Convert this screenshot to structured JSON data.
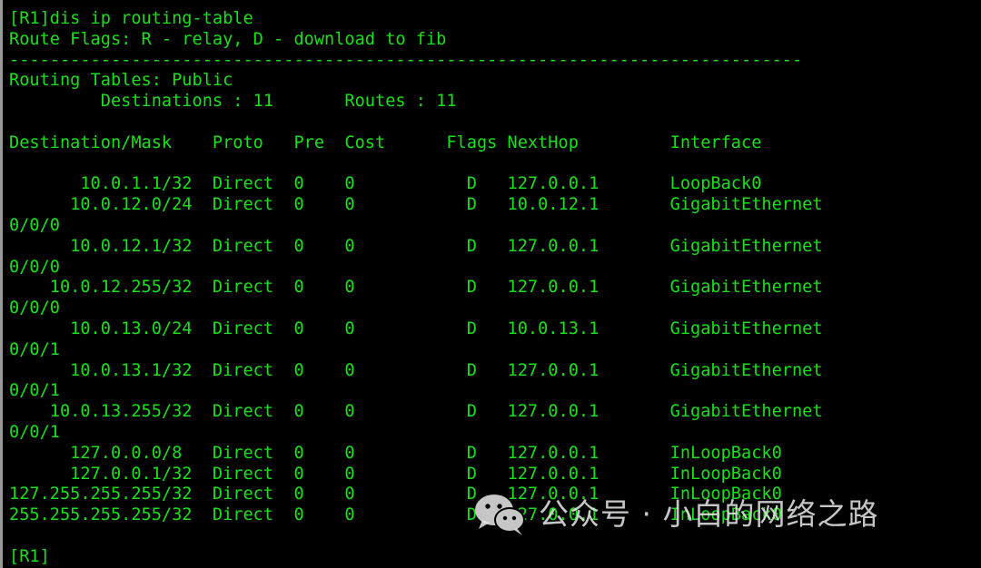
{
  "terminal": {
    "prompt_command": "[R1]dis ip routing-table",
    "flags_legend": "Route Flags: R - relay, D - download to fib",
    "separator": "------------------------------------------------------------------------------",
    "routing_tables": "Routing Tables: Public",
    "summary": "         Destinations : 11       Routes : 11",
    "blank_1": "",
    "header": "Destination/Mask    Proto   Pre  Cost      Flags NextHop         Interface",
    "blank_2": "",
    "routes": [
      "       10.0.1.1/32  Direct  0    0           D   127.0.0.1       LoopBack0",
      "      10.0.12.0/24  Direct  0    0           D   10.0.12.1       GigabitEthernet",
      "0/0/0",
      "      10.0.12.1/32  Direct  0    0           D   127.0.0.1       GigabitEthernet",
      "0/0/0",
      "    10.0.12.255/32  Direct  0    0           D   127.0.0.1       GigabitEthernet",
      "0/0/0",
      "      10.0.13.0/24  Direct  0    0           D   10.0.13.1       GigabitEthernet",
      "0/0/1",
      "      10.0.13.1/32  Direct  0    0           D   127.0.0.1       GigabitEthernet",
      "0/0/1",
      "    10.0.13.255/32  Direct  0    0           D   127.0.0.1       GigabitEthernet",
      "0/0/1",
      "      127.0.0.0/8   Direct  0    0           D   127.0.0.1       InLoopBack0",
      "      127.0.0.1/32  Direct  0    0           D   127.0.0.1       InLoopBack0",
      "127.255.255.255/32  Direct  0    0           D   127.0.0.1       InLoopBack0",
      "255.255.255.255/32  Direct  0    0           D   127.0.0.1       InLoopBack0"
    ],
    "blank_3": "",
    "final_prompt": "[R1]"
  },
  "watermark": {
    "text": "公众号 · 小白的网络之路",
    "icon": "wechat-icon"
  },
  "colors": {
    "background": "#000000",
    "text": "#18e018"
  }
}
